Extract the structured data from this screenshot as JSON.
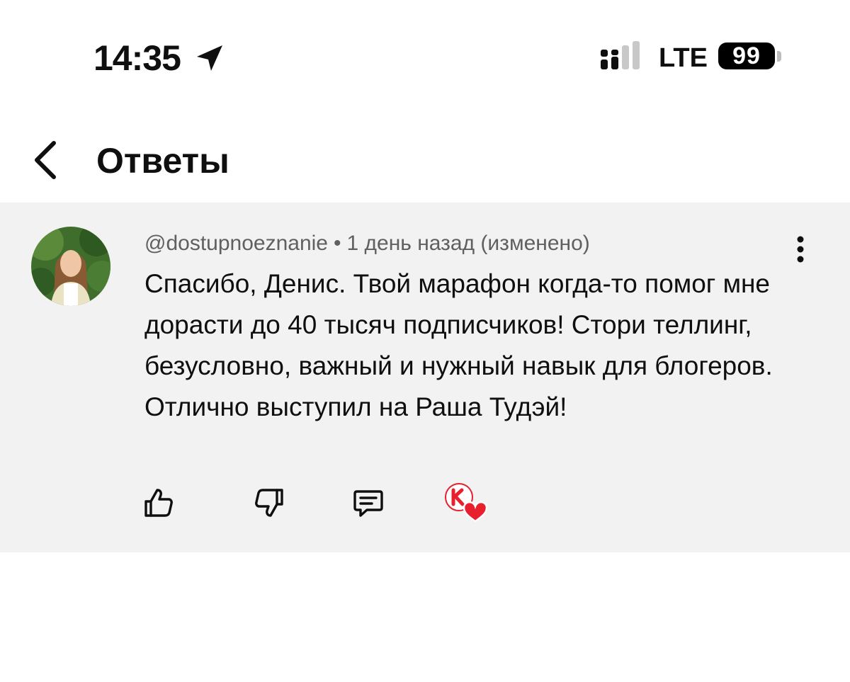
{
  "status_bar": {
    "time": "14:35",
    "network": "LTE",
    "battery": "99"
  },
  "header": {
    "title": "Ответы"
  },
  "comment": {
    "author": "@dostupnoeznanie",
    "separator": "•",
    "time_ago": "1 день назад (изменено)",
    "text": "Спасибо, Денис. Твой марафон когда-то помог мне дорасти до 40 тысяч подписчиков! Стори теллинг, безусловно, важный и нужный навык для блогеров. Отлично выступил на Раша Тудэй!"
  },
  "icons": {
    "location": "location-arrow-icon",
    "back": "chevron-left-icon",
    "more": "more-vertical-icon",
    "like": "thumbs-up-icon",
    "dislike": "thumbs-down-icon",
    "reply": "reply-comment-icon",
    "creator_heart": "creator-heart-icon"
  },
  "colors": {
    "comment_bg": "#f2f2f2",
    "heart": "#e8202e",
    "muted_text": "#606060"
  }
}
